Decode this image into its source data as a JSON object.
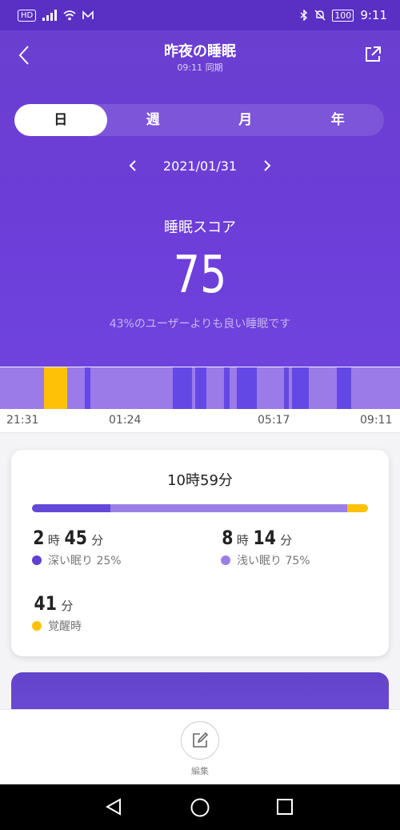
{
  "status_bar": {
    "hd": "HD",
    "battery": "100",
    "time": "9:11"
  },
  "header": {
    "title": "昨夜の睡眠",
    "subtitle": "09:11 同期"
  },
  "period_tabs": [
    {
      "label": "日",
      "active": true
    },
    {
      "label": "週",
      "active": false
    },
    {
      "label": "月",
      "active": false
    },
    {
      "label": "年",
      "active": false
    }
  ],
  "date": "2021/01/31",
  "score": {
    "label": "睡眠スコア",
    "value": "75",
    "description": "43%のユーザーよりも良い睡眠です"
  },
  "timeline": {
    "ticks": [
      "21:31",
      "01:24",
      "05:17",
      "09:11"
    ],
    "colors": {
      "light": "#9b7be8",
      "deep": "#6448e6",
      "awake": "#ffc107"
    },
    "segments": [
      {
        "stage": "light",
        "start": 0.0,
        "end": 0.11
      },
      {
        "stage": "awake",
        "start": 0.11,
        "end": 0.168
      },
      {
        "stage": "light",
        "start": 0.168,
        "end": 0.212
      },
      {
        "stage": "deep",
        "start": 0.212,
        "end": 0.226
      },
      {
        "stage": "light",
        "start": 0.226,
        "end": 0.432
      },
      {
        "stage": "deep",
        "start": 0.432,
        "end": 0.48
      },
      {
        "stage": "light",
        "start": 0.48,
        "end": 0.488
      },
      {
        "stage": "deep",
        "start": 0.488,
        "end": 0.516
      },
      {
        "stage": "light",
        "start": 0.516,
        "end": 0.56
      },
      {
        "stage": "deep",
        "start": 0.56,
        "end": 0.574
      },
      {
        "stage": "light",
        "start": 0.574,
        "end": 0.592
      },
      {
        "stage": "deep",
        "start": 0.592,
        "end": 0.642
      },
      {
        "stage": "light",
        "start": 0.642,
        "end": 0.71
      },
      {
        "stage": "deep",
        "start": 0.71,
        "end": 0.722
      },
      {
        "stage": "light",
        "start": 0.722,
        "end": 0.73
      },
      {
        "stage": "deep",
        "start": 0.73,
        "end": 0.772
      },
      {
        "stage": "light",
        "start": 0.772,
        "end": 0.842
      },
      {
        "stage": "deep",
        "start": 0.842,
        "end": 0.878
      },
      {
        "stage": "light",
        "start": 0.878,
        "end": 1.0
      }
    ]
  },
  "summary": {
    "total": "10時59分",
    "bar": [
      {
        "stage": "deep",
        "fraction": 0.233,
        "color": "#6448d8"
      },
      {
        "stage": "light",
        "fraction": 0.705,
        "color": "#9a80e6"
      },
      {
        "stage": "awake",
        "fraction": 0.062,
        "color": "#ffc107"
      }
    ],
    "deep": {
      "hours": "2",
      "hours_unit": "時",
      "minutes": "45",
      "minutes_unit": "分",
      "label": "深い眠り 25%",
      "color": "#6040d0"
    },
    "light": {
      "hours": "8",
      "hours_unit": "時",
      "minutes": "14",
      "minutes_unit": "分",
      "label": "浅い眠り 75%",
      "color": "#9a80e6"
    },
    "awake": {
      "minutes": "41",
      "minutes_unit": "分",
      "label": "覚醒時",
      "color": "#ffc107"
    }
  },
  "bottom": {
    "edit_label": "編集"
  },
  "icons": {
    "back": "chevron-left-icon",
    "share": "share-icon",
    "edit": "edit-pencil-icon",
    "nav": [
      "back-triangle-icon",
      "home-circle-icon",
      "recents-square-icon"
    ]
  }
}
